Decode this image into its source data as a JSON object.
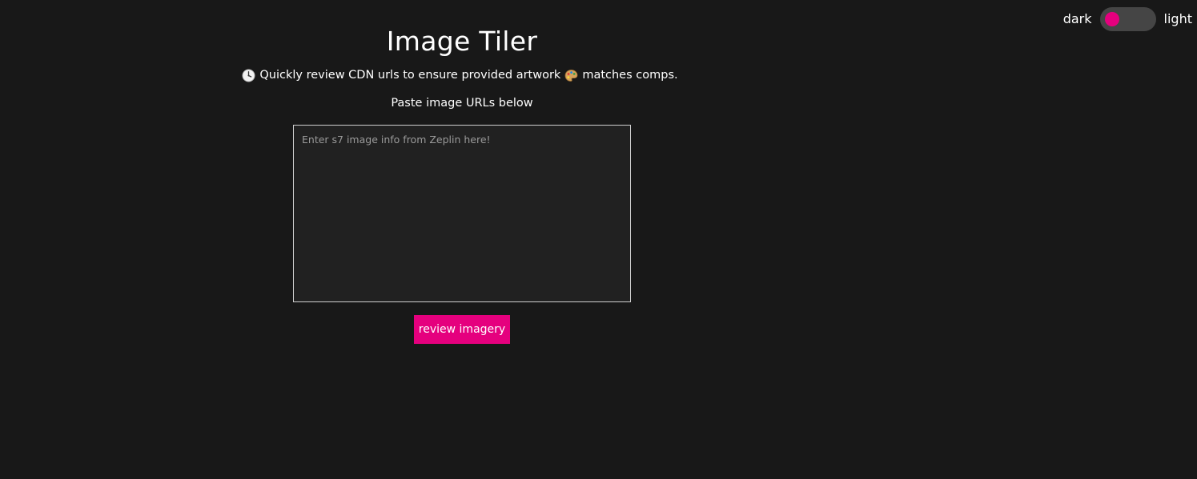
{
  "theme_toggle": {
    "dark_label": "dark",
    "light_label": "light",
    "state": "dark",
    "knob_color": "#e5007e",
    "track_color": "#454545"
  },
  "header": {
    "title": "Image Tiler",
    "tagline": {
      "leading_icon": "clock-icon",
      "part1": "Quickly review CDN urls to ensure provided artwork",
      "middle_icon": "palette-icon",
      "part2": "matches comps."
    },
    "paste_label": "Paste image URLs below"
  },
  "url_input": {
    "value": "",
    "placeholder": "Enter s7 image info from Zeplin here!"
  },
  "review_button": {
    "label": "review imagery",
    "color": "#e5007e"
  },
  "colors": {
    "background": "#181818",
    "textarea_background": "#212121",
    "accent": "#e5007e",
    "text": "#ffffff"
  }
}
